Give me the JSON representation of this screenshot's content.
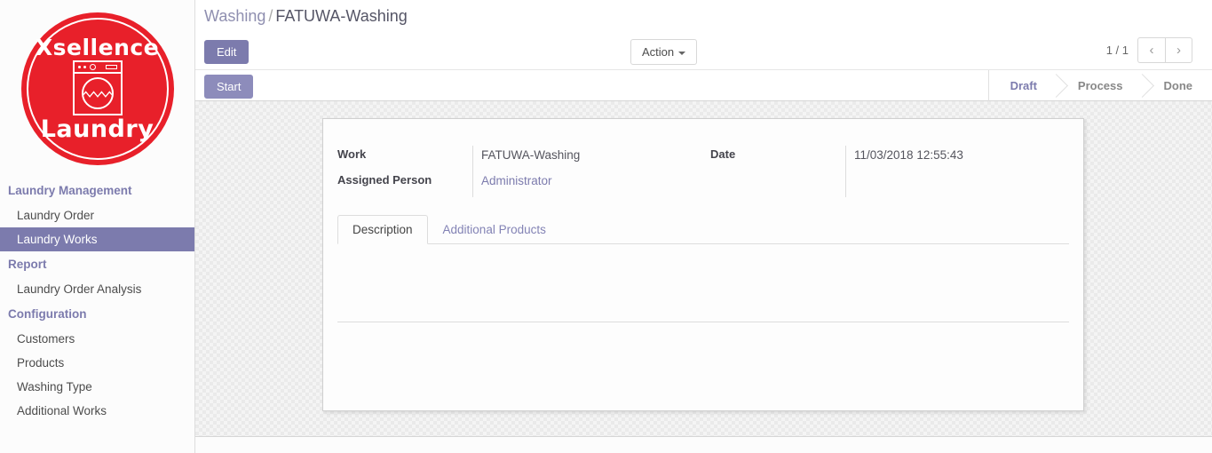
{
  "sidebar": {
    "logo": {
      "top_text": "Xsellence",
      "bottom_text": "Laundry",
      "icon": "washing-machine-icon",
      "brand_color": "#e8202a"
    },
    "groups": [
      {
        "title": "Laundry Management",
        "items": [
          {
            "label": "Laundry Order",
            "active": false
          },
          {
            "label": "Laundry Works",
            "active": true
          }
        ]
      },
      {
        "title": "Report",
        "items": [
          {
            "label": "Laundry Order Analysis",
            "active": false
          }
        ]
      },
      {
        "title": "Configuration",
        "items": [
          {
            "label": "Customers",
            "active": false
          },
          {
            "label": "Products",
            "active": false
          },
          {
            "label": "Washing Type",
            "active": false
          },
          {
            "label": "Additional Works",
            "active": false
          }
        ]
      }
    ]
  },
  "breadcrumb": {
    "parent": "Washing",
    "separator": "/",
    "current": "FATUWA-Washing"
  },
  "toolbar": {
    "edit_label": "Edit",
    "action_label": "Action",
    "action_caret": "caret-down-icon",
    "pager_count": "1 / 1",
    "prev_icon": "‹",
    "next_icon": "›"
  },
  "statusrow": {
    "start_label": "Start",
    "stages": [
      {
        "label": "Draft",
        "active": true
      },
      {
        "label": "Process",
        "active": false
      },
      {
        "label": "Done",
        "active": false
      }
    ]
  },
  "form": {
    "left": {
      "labels": [
        "Work",
        "Assigned Person"
      ],
      "values": [
        "FATUWA-Washing",
        "Administrator"
      ]
    },
    "right": {
      "labels": [
        "Date"
      ],
      "values": [
        "11/03/2018 12:55:43"
      ]
    }
  },
  "notebook": {
    "tabs": [
      {
        "label": "Description",
        "active": true
      },
      {
        "label": "Additional Products",
        "active": false
      }
    ]
  },
  "theme": {
    "accent": "#7c7bad",
    "text": "#4c4c4c"
  }
}
